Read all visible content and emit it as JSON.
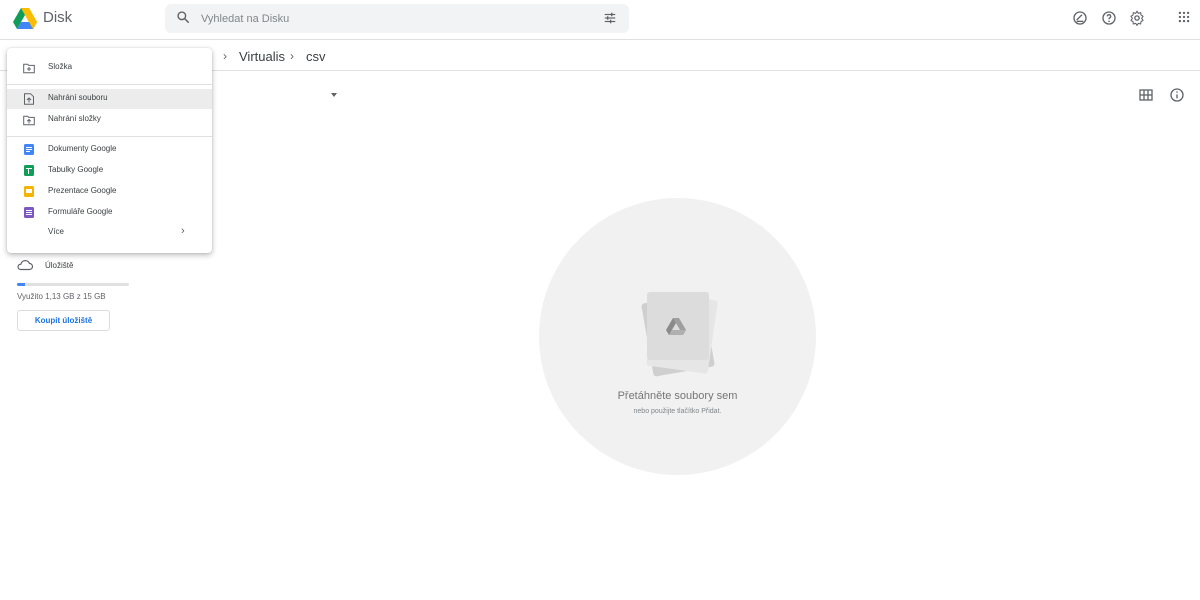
{
  "header": {
    "app_name": "Disk",
    "search_placeholder": "Vyhledat na Disku",
    "icons": [
      "search-icon",
      "search-options-icon",
      "offline-status-icon",
      "help-icon",
      "settings-icon",
      "apps-grid-icon"
    ]
  },
  "breadcrumb": {
    "items": [
      "Virtualis",
      "csv"
    ]
  },
  "toolbar_icons": [
    "grid-view-icon",
    "info-icon"
  ],
  "new_menu": {
    "folder": "Složka",
    "file_upload": "Nahrání souboru",
    "folder_upload": "Nahrání složky",
    "docs": "Dokumenty Google",
    "sheets": "Tabulky Google",
    "slides": "Prezentace Google",
    "forms": "Formuláře Google",
    "more": "Více",
    "highlighted": "Nahrání souboru"
  },
  "storage": {
    "label": "Úložiště",
    "usage": "Využito 1,13 GB z 15 GB",
    "used_fraction": 0.075,
    "buy_label": "Koupit úložiště"
  },
  "empty_state": {
    "title": "Přetáhněte soubory sem",
    "subtitle": "nebo použijte tlačítko Přidat."
  },
  "colors": {
    "docs": "#4285f4",
    "sheets": "#0f9d58",
    "slides": "#f4b400",
    "forms": "#7e57c2",
    "accent": "#1a73e8"
  }
}
